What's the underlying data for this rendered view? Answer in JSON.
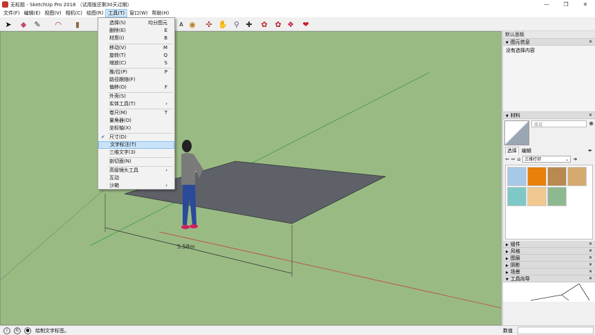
{
  "window": {
    "title": "无标题 - SketchUp Pro 2018 （试用版还剩30天过期）",
    "controls": [
      "—",
      "❐",
      "✕"
    ]
  },
  "menubar": [
    "文件(F)",
    "编辑(E)",
    "视图(V)",
    "相机(C)",
    "绘图(R)",
    "工具(T)",
    "窗口(W)",
    "帮助(H)"
  ],
  "tools_menu": {
    "items": [
      {
        "label": "选择(S)",
        "shortcut": "均分图元"
      },
      {
        "label": "删除(E)",
        "shortcut": "E"
      },
      {
        "label": "材质(I)",
        "shortcut": "B"
      },
      {
        "label": "移动(V)",
        "shortcut": "M"
      },
      {
        "label": "旋转(T)",
        "shortcut": "Q"
      },
      {
        "label": "缩放(C)",
        "shortcut": "S"
      },
      {
        "label": "推/拉(P)",
        "shortcut": "P"
      },
      {
        "label": "路径跟随(F)",
        "shortcut": ""
      },
      {
        "label": "偏移(O)",
        "shortcut": "F"
      },
      {
        "label": "外壳(S)",
        "shortcut": ""
      },
      {
        "label": "实体工具(T)",
        "shortcut": "›"
      },
      {
        "label": "卷尺(M)",
        "shortcut": "T"
      },
      {
        "label": "量角器(O)",
        "shortcut": ""
      },
      {
        "label": "坐标轴(X)",
        "shortcut": ""
      },
      {
        "label": "尺寸(D)",
        "shortcut": ""
      },
      {
        "label": "文字标注(T)",
        "shortcut": ""
      },
      {
        "label": "三维文字(3)",
        "shortcut": ""
      },
      {
        "label": "剖切面(N)",
        "shortcut": ""
      },
      {
        "label": "高级镜头工具",
        "shortcut": "›"
      },
      {
        "label": "互动",
        "shortcut": ""
      },
      {
        "label": "沙箱",
        "shortcut": "›"
      }
    ]
  },
  "viewport": {
    "dimension_label": "5.58m"
  },
  "tray": {
    "title": "默认面板",
    "entity_info": {
      "header": "图元信息",
      "body": "没有选择内容"
    },
    "materials": {
      "header": "材料",
      "name_placeholder": "接设",
      "tabs": [
        "选择",
        "编辑"
      ],
      "collection": "三维打印",
      "swatch_colors": [
        "#a8c8e8",
        "#e8800a",
        "#b88a50",
        "#d4aa70",
        "#80c8c8",
        "#f0c890",
        "#8eb890"
      ]
    },
    "collapsed_sections": [
      "组件",
      "风格",
      "图层",
      "阴影",
      "场景"
    ],
    "instructor": {
      "header": "工具向导"
    }
  },
  "status": {
    "message": "绘制文字标签。",
    "measurements_label": "数值"
  },
  "colors": {
    "sky": "#c8e4f2",
    "ground": "#9aba84",
    "plane": "#5e6268",
    "highlight": "#c8e2f8"
  }
}
